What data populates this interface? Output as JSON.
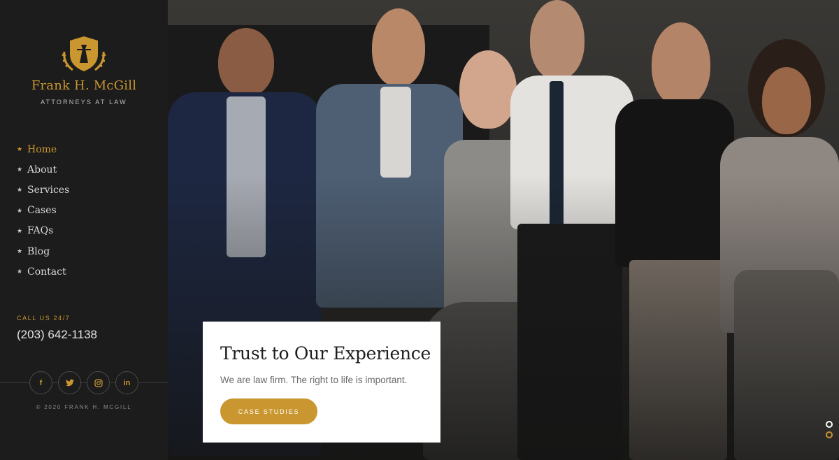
{
  "brand": {
    "name": "Frank H. McGill",
    "subtitle": "ATTORNEYS AT LAW"
  },
  "nav": {
    "items": [
      {
        "label": "Home",
        "active": true
      },
      {
        "label": "About",
        "active": false
      },
      {
        "label": "Services",
        "active": false
      },
      {
        "label": "Cases",
        "active": false
      },
      {
        "label": "FAQs",
        "active": false
      },
      {
        "label": "Blog",
        "active": false
      },
      {
        "label": "Contact",
        "active": false
      }
    ]
  },
  "contact": {
    "call_label": "CALL US 24/7",
    "phone": "(203) 642-1138"
  },
  "social": {
    "facebook": "f",
    "twitter": "t",
    "instagram": "ig",
    "linkedin": "in"
  },
  "footer": {
    "copyright": "© 2020 FRANK H. MCGILL"
  },
  "hero": {
    "title": "Trust to Our Experience",
    "subtitle": "We are law firm. The right to life is important.",
    "cta_label": "CASE STUDIES"
  },
  "colors": {
    "accent": "#c9962f",
    "sidebar_bg": "#1c1c1c",
    "card_bg": "#ffffff"
  },
  "slider": {
    "slide_count": 2,
    "active_index": 1
  }
}
